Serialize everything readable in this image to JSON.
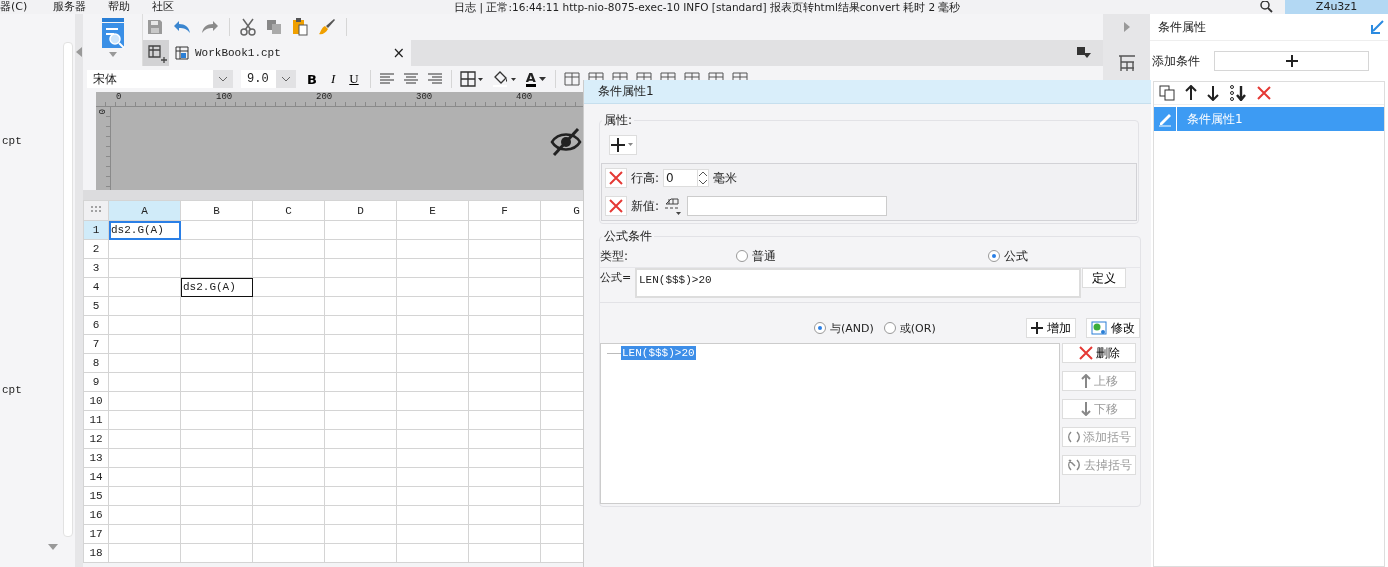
{
  "menu": [
    "器(C)",
    "服务器",
    "帮助",
    "社区"
  ],
  "status_log": "日志 | 正常:16:44:11 http-nio-8075-exec-10 INFO [standard] 报表页转html结果convert  耗时 2 毫秒",
  "user": "Z4u3z1",
  "left_panel": {
    "items": [
      "cpt",
      "cpt"
    ]
  },
  "tab": {
    "label": "WorkBook1.cpt",
    "close": "×"
  },
  "format_toolbar": {
    "font": "宋体",
    "size": "9.0",
    "bold": "B",
    "italic": "I",
    "underline": "U",
    "font_color": "A"
  },
  "ruler": {
    "ticks": [
      "0",
      "100",
      "200",
      "300",
      "400"
    ],
    "vertical_tick": "0"
  },
  "sheet": {
    "columns": [
      {
        "label": "A",
        "selected": true
      },
      {
        "label": "B",
        "selected": false
      },
      {
        "label": "C",
        "selected": false
      },
      {
        "label": "D",
        "selected": false
      },
      {
        "label": "E",
        "selected": false
      },
      {
        "label": "F",
        "selected": false
      },
      {
        "label": "G",
        "selected": false
      }
    ],
    "rows": [
      {
        "label": "1",
        "selected": true,
        "cells": [
          {
            "text": "ds2.G(A)",
            "selected": true
          }
        ]
      },
      {
        "label": "2",
        "selected": false,
        "cells": []
      },
      {
        "label": "3",
        "selected": false,
        "cells": []
      },
      {
        "label": "4",
        "selected": false,
        "cells": [
          null,
          {
            "text": "ds2.G(A)",
            "selected": false
          }
        ]
      },
      {
        "label": "5",
        "selected": false,
        "cells": []
      },
      {
        "label": "6",
        "selected": false,
        "cells": []
      },
      {
        "label": "7",
        "selected": false,
        "cells": []
      },
      {
        "label": "8",
        "selected": false,
        "cells": []
      },
      {
        "label": "9",
        "selected": false,
        "cells": []
      },
      {
        "label": "10",
        "selected": false,
        "cells": []
      },
      {
        "label": "11",
        "selected": false,
        "cells": []
      },
      {
        "label": "12",
        "selected": false,
        "cells": []
      },
      {
        "label": "13",
        "selected": false,
        "cells": []
      },
      {
        "label": "14",
        "selected": false,
        "cells": []
      },
      {
        "label": "15",
        "selected": false,
        "cells": []
      },
      {
        "label": "16",
        "selected": false,
        "cells": []
      },
      {
        "label": "17",
        "selected": false,
        "cells": []
      },
      {
        "label": "18",
        "selected": false,
        "cells": []
      }
    ]
  },
  "right_panel": {
    "title": "条件属性",
    "add_label": "添加条件",
    "conditions": [
      {
        "label": "条件属性1",
        "selected": true
      }
    ]
  },
  "dialog": {
    "title": "条件属性1",
    "properties": {
      "legend": "属性:",
      "items": [
        {
          "kind": "spinner",
          "label": "行高:",
          "value": "0",
          "unit": "毫米"
        },
        {
          "kind": "value",
          "label": "新值:"
        }
      ]
    },
    "formula_condition": {
      "legend": "公式条件",
      "type_label": "类型:",
      "types": [
        {
          "label": "普通",
          "selected": false
        },
        {
          "label": "公式",
          "selected": true
        }
      ],
      "formula_label": "公式=",
      "formula": "LEN($$$)>20",
      "define_button": "定义",
      "logic": [
        {
          "label": "与(AND)",
          "selected": true
        },
        {
          "label": "或(OR)",
          "selected": false
        }
      ],
      "add_button": "增加",
      "modify_button": "修改",
      "conditions": [
        {
          "text": "LEN($$$)>20",
          "selected": true
        }
      ],
      "side_buttons": [
        {
          "kind": "delete",
          "label": "删除",
          "disabled": false
        },
        {
          "kind": "up",
          "label": "上移",
          "disabled": true
        },
        {
          "kind": "down",
          "label": "下移",
          "disabled": true
        },
        {
          "kind": "add-bracket",
          "label": "添加括号",
          "disabled": true
        },
        {
          "kind": "remove-bracket",
          "label": "去掉括号",
          "disabled": true
        }
      ]
    }
  }
}
